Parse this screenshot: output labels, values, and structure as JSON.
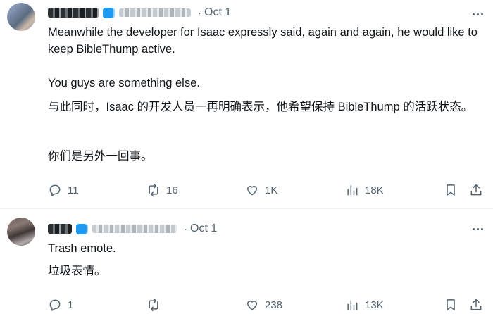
{
  "posts": [
    {
      "date": "Oct 1",
      "dot": "·",
      "paragraphs": [
        "Meanwhile the developer for Isaac expressly said, again and again, he would like to keep BibleThump active.",
        "You guys are something else.",
        "与此同时，Isaac 的开发人员一再明确表示，他希望保持 BibleThump 的活跃状态。",
        "你们是另外一回事。"
      ],
      "stats": {
        "replies": "11",
        "reposts": "16",
        "likes": "1K",
        "views": "18K"
      }
    },
    {
      "date": "Oct 1",
      "dot": "·",
      "paragraphs": [
        "Trash emote.",
        "垃圾表情。"
      ],
      "stats": {
        "replies": "1",
        "reposts": "",
        "likes": "238",
        "views": "13K"
      }
    }
  ],
  "icons": {
    "reply": "speech-bubble-icon",
    "repost": "repost-arrows-icon",
    "like": "heart-icon",
    "views": "bar-chart-icon",
    "bookmark": "bookmark-icon",
    "share": "share-upload-icon",
    "more": "more-dots-icon",
    "verified": "verified-badge-icon"
  },
  "colors": {
    "accent": "#1d9bf0",
    "text": "#0f1419",
    "muted": "#536471",
    "divider": "#eff3f4"
  }
}
